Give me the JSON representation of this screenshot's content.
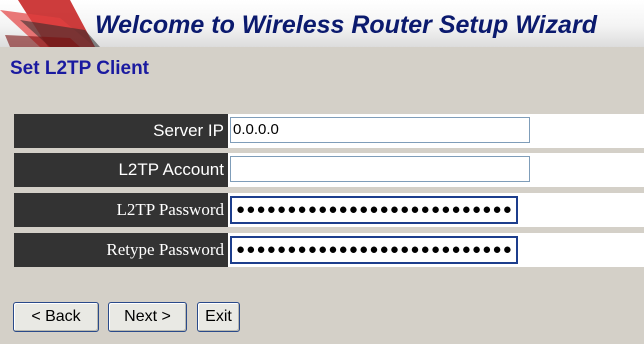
{
  "banner": {
    "title": "Welcome to Wireless Router Setup Wizard"
  },
  "section": {
    "title": "Set L2TP Client"
  },
  "form": {
    "rows": [
      {
        "label": "Server IP",
        "value": "0.0.0.0"
      },
      {
        "label": "L2TP Account",
        "value": ""
      },
      {
        "label": "L2TP Password",
        "value": "●●●●●●●●●●●●●●●●●●●●●●●●●●●"
      },
      {
        "label": "Retype Password",
        "value": "●●●●●●●●●●●●●●●●●●●●●●●●●●●"
      }
    ]
  },
  "buttons": {
    "back": "< Back",
    "next": "Next >",
    "exit": "Exit"
  },
  "colors": {
    "title_blue": "#0b1a6e",
    "label_bg": "#333333",
    "page_bg": "#d4d0c8"
  }
}
